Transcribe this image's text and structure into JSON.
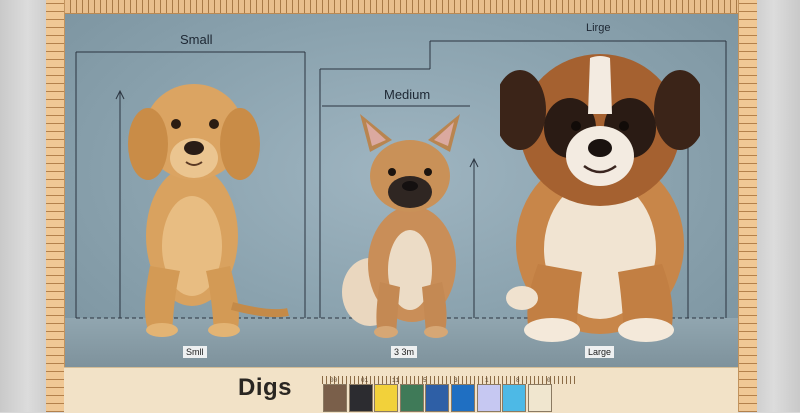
{
  "labels": {
    "small_top": "Small",
    "medium_top": "Medium",
    "large_top": "Lirge",
    "small_tag": "Smll",
    "medium_tag": "3 3m",
    "large_tag": "Large"
  },
  "caption": "Digs",
  "swatch_numbers": [
    "00",
    "01",
    "11",
    "5",
    "3",
    "1",
    "8",
    "0"
  ],
  "swatches": [
    "#7a5f4a",
    "#2c2c30",
    "#f2d13a",
    "#3f7a58",
    "#2e5fa6",
    "#1f6fc2",
    "#c6c8f2",
    "#4db9e6",
    "#f0e6cf"
  ],
  "colors": {
    "ruler": "#f0c895",
    "backdrop": "#8ea7b3",
    "band": "#f2e2c7"
  }
}
